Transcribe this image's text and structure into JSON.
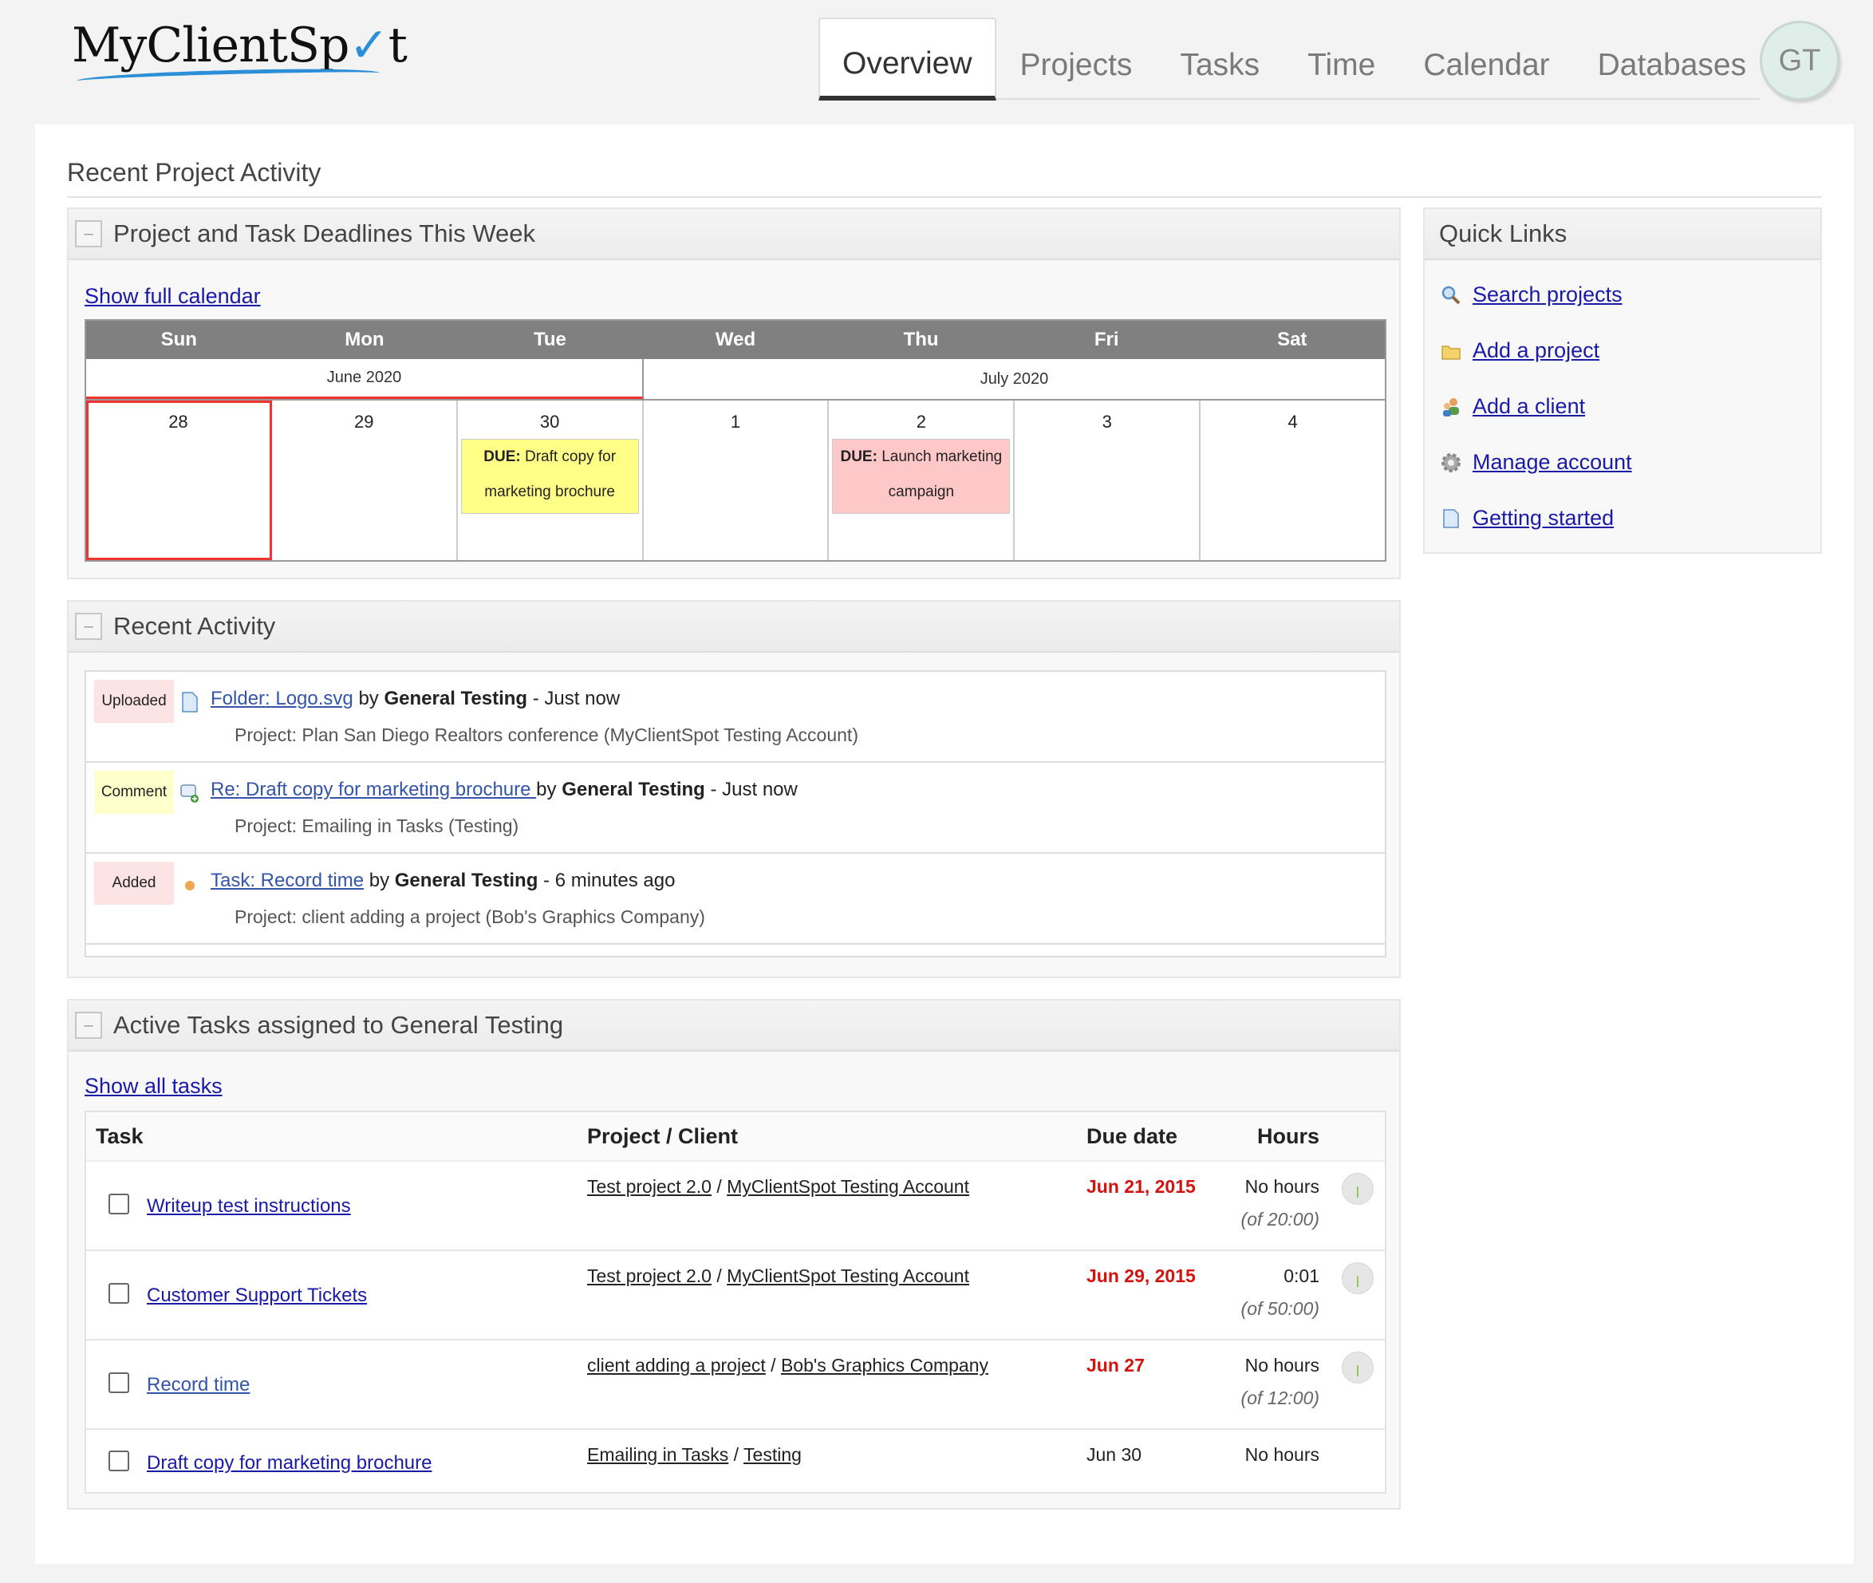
{
  "header": {
    "logo_text_1": "MyClientSp",
    "logo_check": "✓",
    "logo_text_2": "t",
    "tabs": [
      "Overview",
      "Projects",
      "Tasks",
      "Time",
      "Calendar",
      "Databases"
    ],
    "active_tab": "Overview",
    "avatar_initials": "GT"
  },
  "page_title": "Recent Project Activity",
  "deadlines": {
    "title": "Project and Task Deadlines This Week",
    "toggle": "–",
    "show_calendar": "Show full calendar",
    "weekdays": [
      "Sun",
      "Mon",
      "Tue",
      "Wed",
      "Thu",
      "Fri",
      "Sat"
    ],
    "months": [
      "June 2020",
      "July 2020"
    ],
    "days": [
      "28",
      "29",
      "30",
      "1",
      "2",
      "3",
      "4"
    ],
    "events": [
      {
        "day": "30",
        "prefix": "DUE:",
        "text": "Draft copy for marketing brochure",
        "color": "#ffff88"
      },
      {
        "day": "2",
        "prefix": "DUE:",
        "text": "Launch marketing campaign",
        "color": "#ffc8c8"
      }
    ]
  },
  "quick_links": {
    "title": "Quick Links",
    "items": [
      {
        "label": "Search projects",
        "icon": "magnifier-icon"
      },
      {
        "label": "Add a project",
        "icon": "folder-icon"
      },
      {
        "label": "Add a client",
        "icon": "users-icon"
      },
      {
        "label": "Manage account",
        "icon": "gear-icon"
      },
      {
        "label": "Getting started",
        "icon": "document-icon"
      }
    ]
  },
  "recent_activity": {
    "title": "Recent Activity",
    "toggle": "–",
    "items": [
      {
        "badge": "Uploaded",
        "link": "Folder: Logo.svg",
        "by": "by",
        "user": "General Testing",
        "when": "- Just now",
        "project": "Project: Plan San Diego Realtors conference (MyClientSpot Testing Account)"
      },
      {
        "badge": "Comment",
        "link": "Re: Draft copy for marketing brochure ",
        "by": "by",
        "user": "General Testing",
        "when": "- Just now",
        "project": "Project: Emailing in Tasks (Testing)"
      },
      {
        "badge": "Added",
        "link": "Task: Record time",
        "by": "by",
        "user": "General Testing",
        "when": "- 6 minutes ago",
        "project": "Project: client adding a project (Bob's Graphics Company)"
      }
    ]
  },
  "active_tasks": {
    "title": "Active Tasks assigned to General Testing",
    "toggle": "–",
    "show_all": "Show all tasks",
    "columns": [
      "Task",
      "Project / Client",
      "Due date",
      "Hours"
    ],
    "rows": [
      {
        "task": "Writeup test instructions",
        "project": "Test project 2.0",
        "sep": "/",
        "client": "MyClientSpot Testing Account",
        "due": "Jun 21, 2015",
        "hours": "No hours",
        "of": "(of 20:00)"
      },
      {
        "task": "Customer Support Tickets",
        "project": "Test project 2.0",
        "sep": "/",
        "client": "MyClientSpot Testing Account",
        "due": "Jun 29, 2015",
        "hours": "0:01",
        "of": "(of 50:00)"
      },
      {
        "task": "Record time",
        "project": "client adding a project",
        "sep": "/",
        "client": "Bob's Graphics Company",
        "due": "Jun 27",
        "hours": "No hours",
        "of": "(of 12:00)"
      },
      {
        "task": "Draft copy for marketing brochure",
        "project": "Emailing in Tasks",
        "sep": "/",
        "client": "Testing",
        "due": "Jun 30",
        "hours": "No hours",
        "of": ""
      }
    ]
  },
  "colors": {
    "accent_blue": "#2a8fd6",
    "link": "#1a1aa8",
    "overdue_red": "#d4120e",
    "today_outline": "#ee3333"
  }
}
